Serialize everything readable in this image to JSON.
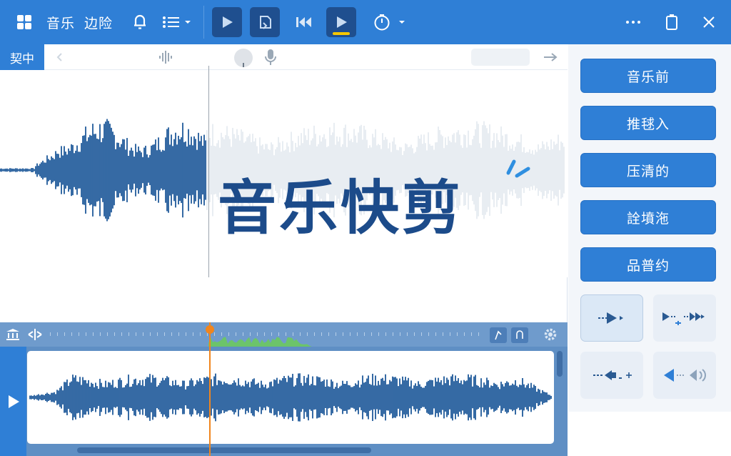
{
  "toolbar": {
    "title_part1": "音乐",
    "title_part2": "边险",
    "icons": [
      "app-grid-icon",
      "bell-icon",
      "list-icon",
      "play-icon",
      "clip-icon",
      "rewind-icon",
      "play-icon",
      "timer-icon",
      "more-icon",
      "battery-icon",
      "close-icon"
    ]
  },
  "subbar": {
    "mode_tab": "契中"
  },
  "main": {
    "title": "音乐快剪"
  },
  "panel": {
    "buttons": [
      "音乐前",
      "推毬入",
      "压清的",
      "詮墳沲",
      "品普约"
    ]
  },
  "colors": {
    "accent": "#2f7fd6",
    "dark_accent": "#1f4f8f",
    "waveform": "#1f5a9a",
    "playhead": "#f0851e",
    "highlight_yellow": "#f6c700",
    "green_region": "#6cc46a"
  }
}
